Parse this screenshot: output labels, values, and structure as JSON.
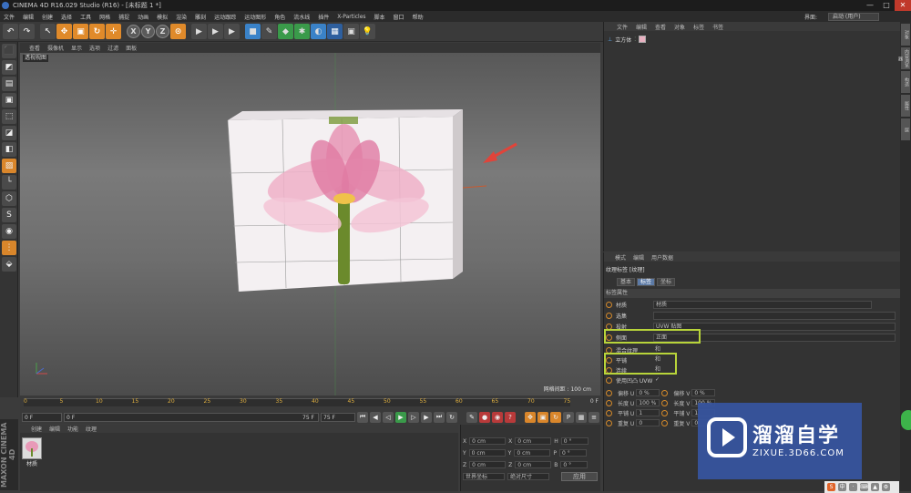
{
  "window": {
    "title": "CINEMA 4D R16.029 Studio (R16) - [未标题 1 *]",
    "min": "—",
    "max": "□",
    "close": "✕"
  },
  "menu": [
    "文件",
    "编辑",
    "创建",
    "选择",
    "工具",
    "网格",
    "捕捉",
    "动画",
    "模拟",
    "渲染",
    "雕刻",
    "运动跟踪",
    "运动图形",
    "角色",
    "流水线",
    "插件",
    "X-Particles",
    "脚本",
    "窗口",
    "帮助"
  ],
  "interface": {
    "label": "界面:",
    "value": "启动 (用户)"
  },
  "toolbar": {
    "undo": "↶",
    "redo": "↷",
    "move": "✥",
    "scale": "▣",
    "rotate": "↻",
    "x": "X",
    "y": "Y",
    "z": "Z",
    "world": "⊙",
    "render1": "▶",
    "render2": "▶",
    "render3": "▶",
    "cube": "■",
    "pen": "✎",
    "sub": "◆",
    "clone": "✱",
    "deform": "◐",
    "floor": "▦",
    "camera": "▣",
    "light": "💡"
  },
  "left_tools": [
    "⬛",
    "◩",
    "▤",
    "▣",
    "⬚",
    "◪",
    "◧",
    "▨",
    "└",
    "⬡",
    "S",
    "◉",
    "⋮",
    "⬙"
  ],
  "viewport": {
    "menu": [
      "查看",
      "摄像机",
      "显示",
      "选项",
      "过滤",
      "面板"
    ],
    "label": "透视视图",
    "grid_info": "网格间距 : 100 cm"
  },
  "timeline": {
    "ticks": [
      "0",
      "5",
      "10",
      "15",
      "20",
      "25",
      "30",
      "35",
      "40",
      "45",
      "50",
      "55",
      "60",
      "65",
      "70",
      "75"
    ],
    "current": "0 F"
  },
  "playback": {
    "start": "0 F",
    "inner_start": "0 F",
    "inner_end": "75 F",
    "end": "75 F"
  },
  "materials": {
    "menu": [
      "创建",
      "编辑",
      "功能",
      "纹理"
    ],
    "name": "材质"
  },
  "coords": {
    "rows": [
      {
        "axis": "X",
        "pos": "0 cm",
        "axis2": "X",
        "size": "0 cm",
        "rot_label": "H",
        "rot": "0 °"
      },
      {
        "axis": "Y",
        "pos": "0 cm",
        "axis2": "Y",
        "size": "0 cm",
        "rot_label": "P",
        "rot": "0 °"
      },
      {
        "axis": "Z",
        "pos": "0 cm",
        "axis2": "Z",
        "size": "0 cm",
        "rot_label": "B",
        "rot": "0 °"
      }
    ],
    "mode": "世界坐标",
    "scale_mode": "绝对尺寸",
    "apply": "应用"
  },
  "objects": {
    "menu": [
      "文件",
      "编辑",
      "查看",
      "对象",
      "标签",
      "书签"
    ],
    "item": "立方体"
  },
  "attributes": {
    "menu": [
      "模式",
      "编辑",
      "用户数据"
    ],
    "title": "纹理标签 [纹理]",
    "tabs": [
      "基本",
      "标签",
      "坐标"
    ],
    "section": "标签属性",
    "rows": [
      {
        "label": "材质",
        "value": "材质"
      },
      {
        "label": "选集",
        "value": ""
      },
      {
        "label": "投射",
        "value": "UVW 贴图"
      },
      {
        "label": "侧面",
        "value": "正面"
      },
      {
        "label": "混合纹理",
        "value": "和"
      },
      {
        "label": "平铺",
        "value": "和"
      },
      {
        "label": "连续",
        "value": "和"
      },
      {
        "label": "使用凹凸 UVW",
        "value": "✓"
      }
    ],
    "uv": [
      {
        "l1": "偏移 U",
        "v1": "0 %",
        "l2": "偏移 V",
        "v2": "0 %"
      },
      {
        "l1": "长度 U",
        "v1": "100 %",
        "l2": "长度 V",
        "v2": "100 %"
      },
      {
        "l1": "平铺 U",
        "v1": "1",
        "l2": "平铺 V",
        "v2": "1"
      },
      {
        "l1": "重复 U",
        "v1": "0",
        "l2": "重复 V",
        "v2": "0"
      }
    ]
  },
  "right_strip": [
    "对象",
    "内容浏览器",
    "构造",
    "属性",
    "层"
  ],
  "watermark": {
    "title": "溜溜自学",
    "url": "ZIXUE.3D66.COM"
  },
  "maxon": "MAXON CINEMA 4D",
  "colors": {
    "accent": "#d9862b",
    "highlight": "#b8d43a",
    "selected": "#5c7aa6",
    "arrow": "#e0443a"
  }
}
